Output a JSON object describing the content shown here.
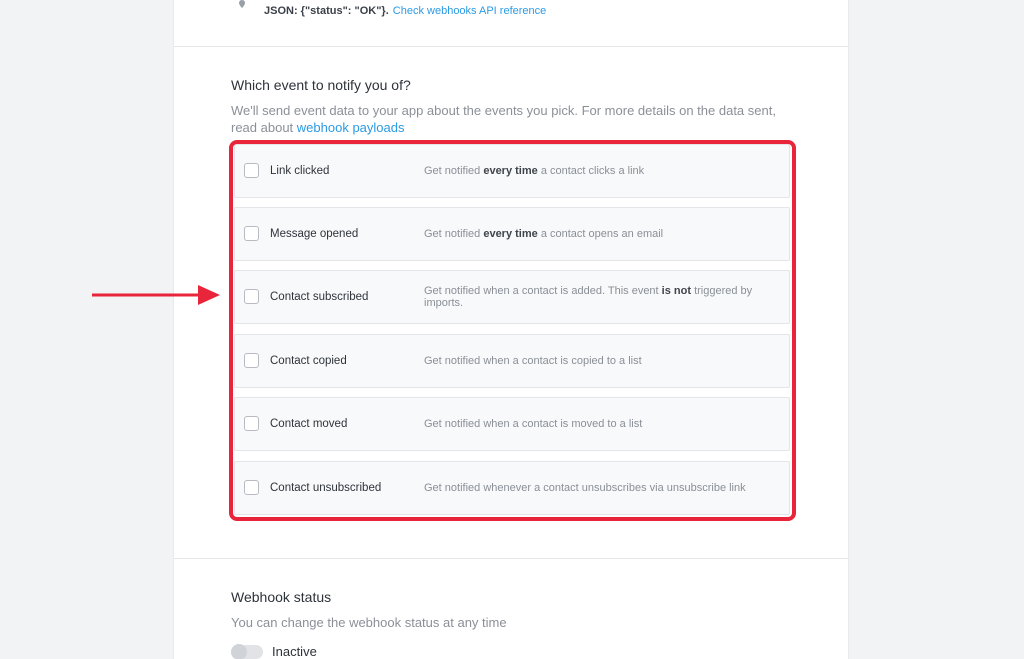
{
  "top": {
    "json_text": "JSON: {\"status\": \"OK\"}.",
    "link_text": "Check webhooks API reference"
  },
  "events_section": {
    "title": "Which event to notify you of?",
    "subtitle_text": "We'll send event data to your app about the events you pick. For more details on the data sent, read about",
    "subtitle_link": "webhook payloads",
    "items": [
      {
        "label": "Link clicked",
        "desc_pre": "Get notified ",
        "desc_bold": "every time",
        "desc_post": " a contact clicks a link"
      },
      {
        "label": "Message opened",
        "desc_pre": "Get notified ",
        "desc_bold": "every time",
        "desc_post": " a contact opens an email"
      },
      {
        "label": "Contact subscribed",
        "desc_pre": "Get notified when a contact is added. This event ",
        "desc_bold": "is not",
        "desc_post": " triggered by imports."
      },
      {
        "label": "Contact copied",
        "desc_pre": "Get notified when a contact is copied to a list",
        "desc_bold": "",
        "desc_post": ""
      },
      {
        "label": "Contact moved",
        "desc_pre": "Get notified when a contact is moved to a list",
        "desc_bold": "",
        "desc_post": ""
      },
      {
        "label": "Contact unsubscribed",
        "desc_pre": "Get notified whenever a contact unsubscribes via unsubscribe link",
        "desc_bold": "",
        "desc_post": ""
      }
    ]
  },
  "status_section": {
    "title": "Webhook status",
    "subtitle": "You can change the webhook status at any time",
    "toggle_label": "Inactive"
  },
  "colors": {
    "accent_link": "#2b9be4",
    "highlight": "#e8253b"
  }
}
